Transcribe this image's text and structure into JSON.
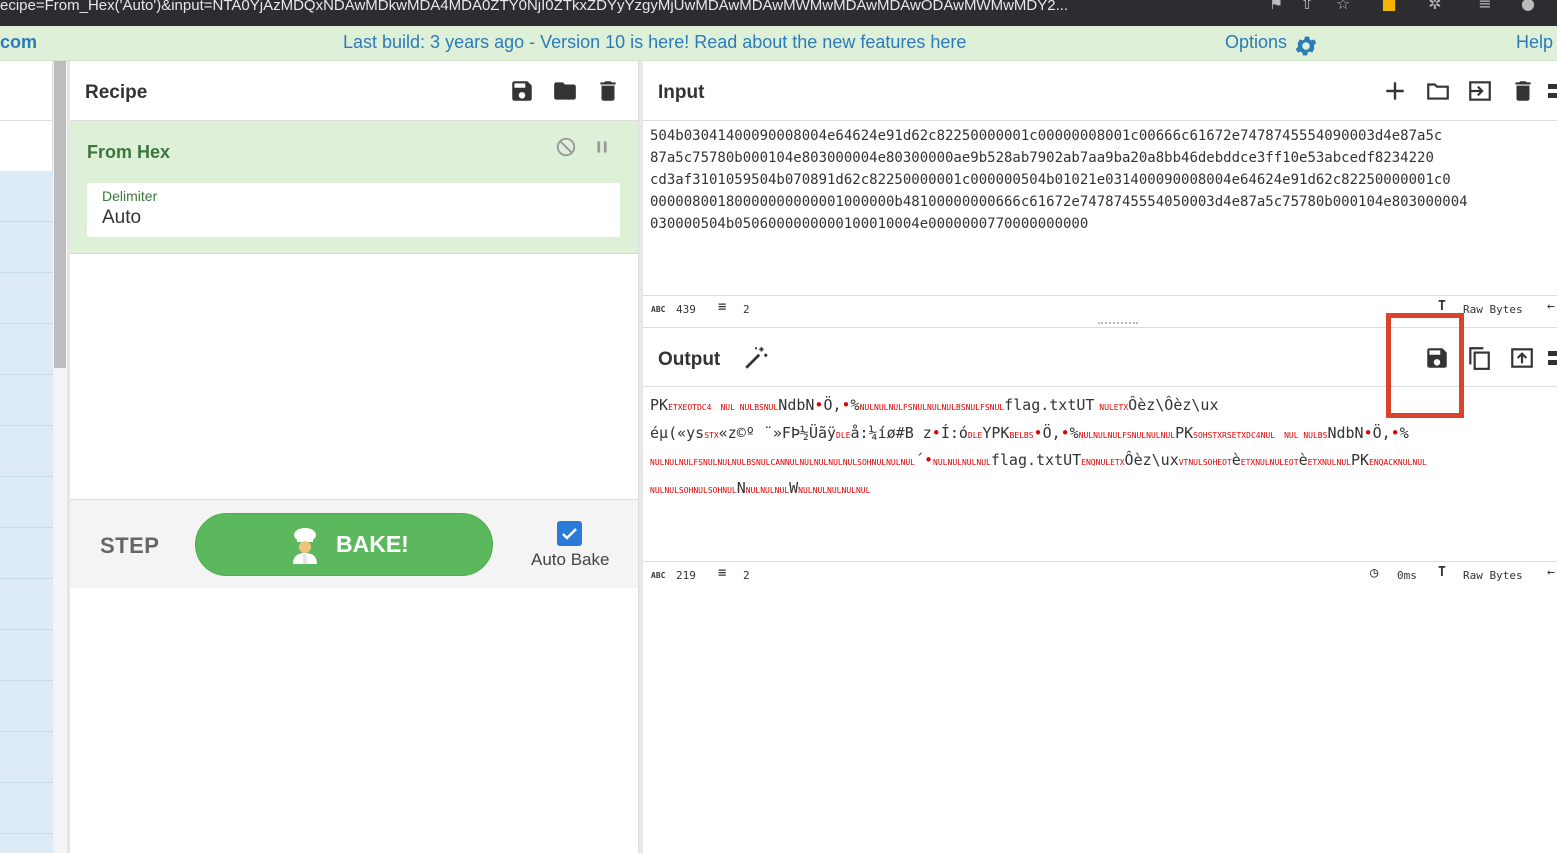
{
  "browser": {
    "url_fragment": "ecipe=From_Hex('Auto')&input=NTA0YjAzMDQxNDAwMDkwMDA4MDA0ZTY0NjI0ZTkxZDYyYzgyMjUwMDAwMDAwMWMwMDAwMDAwODAwMWMwMDY2..."
  },
  "banner": {
    "brand": "com",
    "notice": "Last build: 3 years ago - Version 10 is here! Read about the new features here",
    "options_label": "Options",
    "help_label": "Help"
  },
  "recipe": {
    "title": "Recipe",
    "operation_name": "From Hex",
    "delimiter_label": "Delimiter",
    "delimiter_value": "Auto"
  },
  "controls": {
    "step_label": "STEP",
    "bake_label": "BAKE!",
    "auto_bake_label": "Auto Bake",
    "auto_bake_checked": true
  },
  "input": {
    "title": "Input",
    "lines": [
      "504b03041400090008004e64624e91d62c82250000001c00000008001c00666c61672e7478745554090003d4e87a5c",
      "87a5c75780b000104e803000004e80300000ae9b528ab7902ab7aa9ba20a8bb46debddce3ff10e53abcedf8234220",
      "cd3af3101059504b070891d62c82250000001c000000504b01021e031400090008004e64624e91d62c82250000001c0",
      "00000800180000000000001000000b48100000000666c61672e7478745554050003d4e87a5c75780b000104e803000004",
      "030000504b0506000000000100010004e0000000770000000000"
    ],
    "length": "439",
    "lines_count": "2",
    "format_label": "Raw Bytes"
  },
  "output": {
    "title": "Output",
    "line1": "PK\u0003\u0004\u0014 \u0000\t\u0000\b\u0000NdbN•Ö,•%\u0000\u0000\u0000\u001c\u0000\u0000\u0000\b\u0000\u001c\u0000flag.txtUT\t\u0000\u0003Ôèz\\Ôèz\\ux",
    "line2": "éµ(«ys\u0002«z©º ¨»FÞ½Üãÿ\u0010å:¼íø#B z•Í:ó\u0010YPK\u0007\b•Ö,•%\u0000\u0000\u0000\u001c\u0000\u0000\u0000PK\u0001\u0002\u001e\u0003\u0014\u0000 \u0000\t\u0000\bNdbN•Ö,•%",
    "line3": "\u0000\u0000\u0000\u001c\u0000\u0000\u0000\b\u0000\u0018\u0000\u0000\u0000\u0000\u0000\u0001\u0000\u0000\u0000´•\u0000\u0000\u0000\u0000flag.txtUT\u0005\u0000\u0003Ôèz\\ux\u000b\u0000\u0001\u0004è\u0003\u0000\u0000\u0004è\u0003\u0000\u0000PK\u0005\u0006\u0000\u0000",
    "line4": "\u0000\u0000\u0001\u0000\u0001\u0000N\u0000\u0000\u0000W\u0000\u0000\u0000\u0000\u0000",
    "length": "219",
    "lines_count": "2",
    "time": "0ms",
    "format_label": "Raw Bytes"
  },
  "icons": {
    "save": "save-icon",
    "folder": "folder-icon",
    "trash": "trash-icon",
    "disable": "disable-icon",
    "pause": "pause-icon",
    "plus": "plus-icon",
    "import": "import-icon",
    "magic": "magic-wand-icon",
    "copy": "copy-icon",
    "replace": "replace-input-icon",
    "clock": "clock-icon",
    "gear": "gear-icon",
    "chef": "chef-icon"
  },
  "colors": {
    "accent": "#2b7bb9",
    "bake_green": "#5cb85c",
    "highlight": "#d9432c",
    "control_char": "#dd0000"
  }
}
